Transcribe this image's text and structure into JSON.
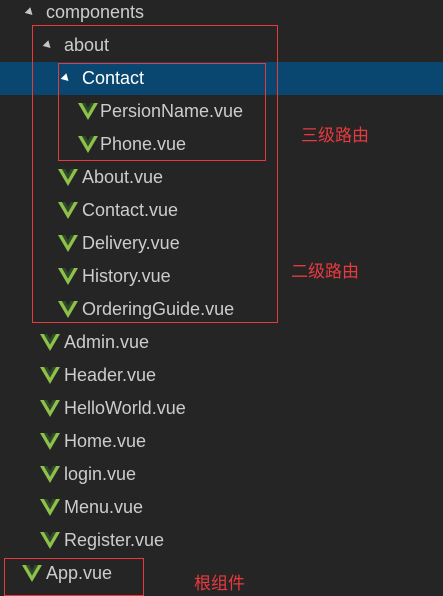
{
  "tree": {
    "folders": {
      "components": "components",
      "about": "about",
      "contact": "Contact"
    },
    "contact_files": [
      "PersionName.vue",
      "Phone.vue"
    ],
    "about_files": [
      "About.vue",
      "Contact.vue",
      "Delivery.vue",
      "History.vue",
      "OrderingGuide.vue"
    ],
    "component_files": [
      "Admin.vue",
      "Header.vue",
      "HelloWorld.vue",
      "Home.vue",
      "login.vue",
      "Menu.vue",
      "Register.vue"
    ],
    "root_file": "App.vue"
  },
  "annotations": {
    "level3": "三级路由",
    "level2": "二级路由",
    "root": "根组件"
  },
  "colors": {
    "background": "#252526",
    "selection": "#094771",
    "vue_green": "#8dc149",
    "annotation_red": "#e8393f"
  },
  "icons": {
    "folder_expanded": "chevron-expanded-icon",
    "vue_file": "vue-file-icon"
  }
}
